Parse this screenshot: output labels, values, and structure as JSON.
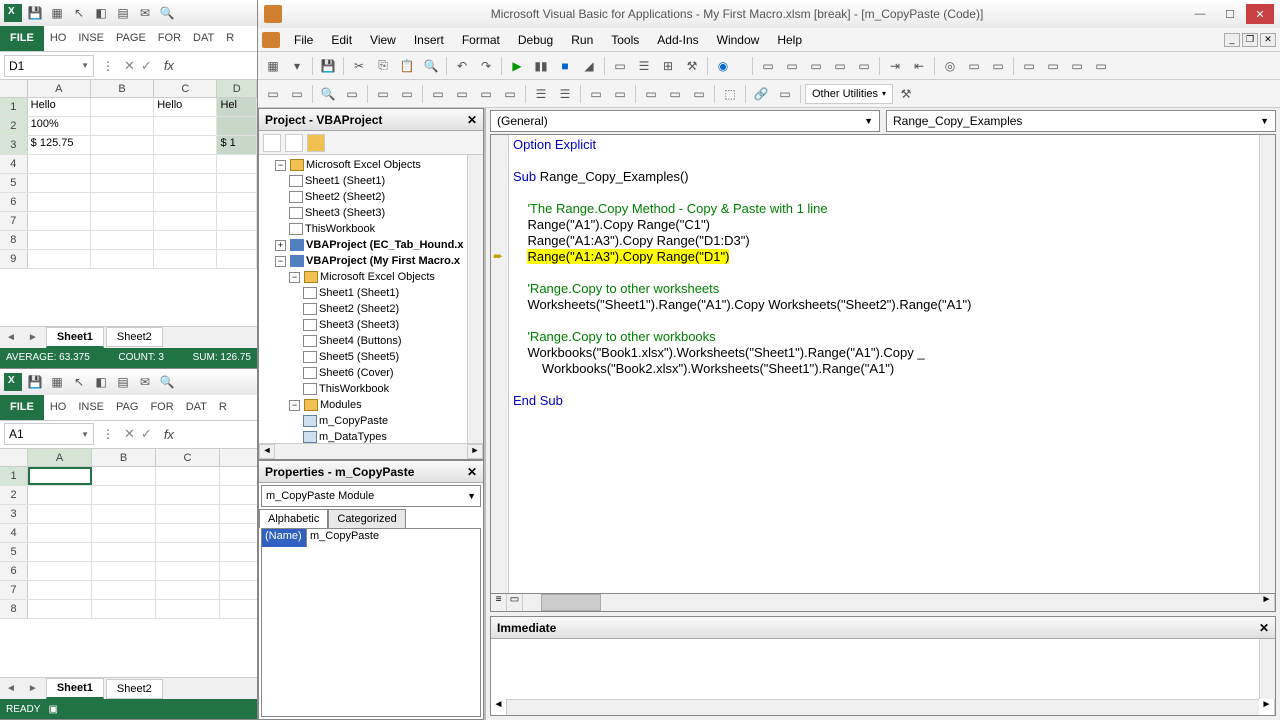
{
  "excel1": {
    "qat_icons": [
      "save",
      "print",
      "cursor",
      "shape",
      "table",
      "mail",
      "find"
    ],
    "file_label": "FILE",
    "ribbon_tabs": [
      "HO",
      "INSE",
      "PAGE",
      "FOR",
      "DAT",
      "R"
    ],
    "name_box": "D1",
    "col_headers": [
      "A",
      "B",
      "C",
      "D"
    ],
    "rows": [
      [
        "Hello",
        "",
        "Hello",
        "Hel"
      ],
      [
        "100%",
        "",
        "",
        ""
      ],
      [
        "$ 125.75",
        "",
        "",
        "$ 1"
      ],
      [
        "",
        "",
        "",
        ""
      ],
      [
        "",
        "",
        "",
        ""
      ],
      [
        "",
        "",
        "",
        ""
      ],
      [
        "",
        "",
        "",
        ""
      ],
      [
        "",
        "",
        "",
        ""
      ],
      [
        "",
        "",
        "",
        ""
      ]
    ],
    "selected_cols": [
      3
    ],
    "selected_rows": [
      0,
      1,
      2
    ],
    "sheet_tabs": [
      "Sheet1",
      "Sheet2"
    ],
    "active_sheet": 0,
    "status": {
      "average": "AVERAGE: 63.375",
      "count": "COUNT: 3",
      "sum": "SUM: 126.75"
    }
  },
  "excel2": {
    "file_label": "FILE",
    "ribbon_tabs": [
      "HO",
      "INSE",
      "PAG",
      "FOR",
      "DAT",
      "R"
    ],
    "name_box": "A1",
    "col_headers": [
      "A",
      "B",
      "C"
    ],
    "row_count": 8,
    "sheet_tabs": [
      "Sheet1",
      "Sheet2"
    ],
    "active_sheet": 0,
    "status": "READY"
  },
  "vbe": {
    "title": "Microsoft Visual Basic for Applications - My First Macro.xlsm [break] - [m_CopyPaste (Code)]",
    "menus": [
      "File",
      "Edit",
      "View",
      "Insert",
      "Format",
      "Debug",
      "Run",
      "Tools",
      "Add-Ins",
      "Window",
      "Help"
    ],
    "other_utilities": "Other Utilities",
    "project_title": "Project - VBAProject",
    "tree": {
      "proj1": "VBAProject (EC_Tab_Hound.x",
      "proj2": "VBAProject (My First Macro.x",
      "meo": "Microsoft Excel Objects",
      "sheets1": [
        "Sheet1 (Sheet1)",
        "Sheet2 (Sheet2)",
        "Sheet3 (Sheet3)",
        "ThisWorkbook"
      ],
      "sheets2": [
        "Sheet1 (Sheet1)",
        "Sheet2 (Sheet2)",
        "Sheet3 (Sheet3)",
        "Sheet4 (Buttons)",
        "Sheet5 (Sheet5)",
        "Sheet6 (Cover)",
        "ThisWorkbook"
      ],
      "modules_label": "Modules",
      "modules": [
        "m_CopyPaste",
        "m_DataTypes"
      ]
    },
    "properties_title": "Properties - m_CopyPaste",
    "props_combo": "m_CopyPaste Module",
    "props_tabs": [
      "Alphabetic",
      "Categorized"
    ],
    "prop_name": "(Name)",
    "prop_val": "m_CopyPaste",
    "code_combo_left": "(General)",
    "code_combo_right": "Range_Copy_Examples",
    "immediate_title": "Immediate",
    "code": {
      "l1": "Option Explicit",
      "l2": "Sub Range_Copy_Examples()",
      "l3": "'The Range.Copy Method - Copy & Paste with 1 line",
      "l4": "Range(\"A1\").Copy Range(\"C1\")",
      "l5": "Range(\"A1:A3\").Copy Range(\"D1:D3\")",
      "l6": "Range(\"A1:A3\").Copy Range(\"D1\")",
      "l7": "'Range.Copy to other worksheets",
      "l8": "Worksheets(\"Sheet1\").Range(\"A1\").Copy Worksheets(\"Sheet2\").Range(\"A1\")",
      "l9": "'Range.Copy to other workbooks",
      "l10": "Workbooks(\"Book1.xlsx\").Worksheets(\"Sheet1\").Range(\"A1\").Copy _",
      "l11": "Workbooks(\"Book2.xlsx\").Worksheets(\"Sheet1\").Range(\"A1\")",
      "l12": "End Sub"
    }
  }
}
